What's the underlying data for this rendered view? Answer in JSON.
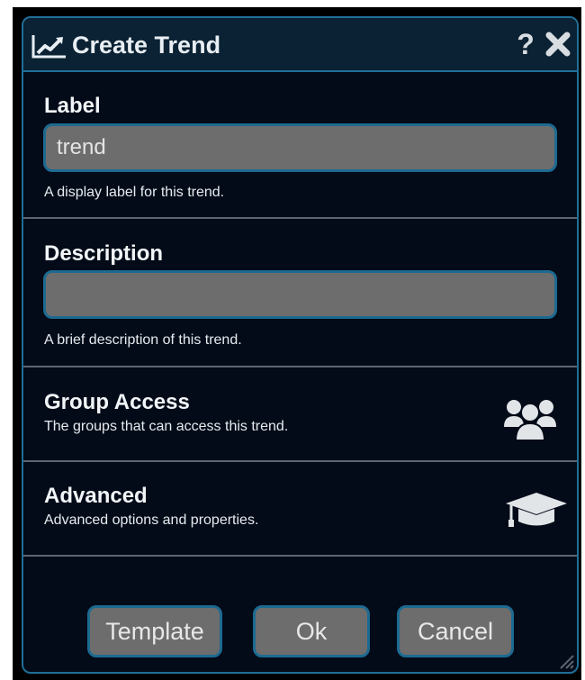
{
  "dialog": {
    "title": "Create Trend",
    "help_glyph": "?",
    "icons": {
      "title": "trend-chart-icon",
      "help": "help-icon",
      "close": "close-icon",
      "group_access": "users-icon",
      "advanced": "graduation-cap-icon"
    }
  },
  "fields": {
    "label": {
      "title": "Label",
      "value": "trend",
      "hint": "A display label for this trend."
    },
    "description": {
      "title": "Description",
      "value": "",
      "hint": "A brief description of this trend."
    }
  },
  "sections": {
    "group_access": {
      "title": "Group Access",
      "subtitle": "The groups that can access this trend."
    },
    "advanced": {
      "title": "Advanced",
      "subtitle": "Advanced options and properties."
    }
  },
  "buttons": {
    "template": "Template",
    "ok": "Ok",
    "cancel": "Cancel"
  },
  "colors": {
    "background": "#030b18",
    "accent_border": "#1f6f97",
    "input_fill": "#6d6d6d",
    "text": "#f2f5f8"
  }
}
